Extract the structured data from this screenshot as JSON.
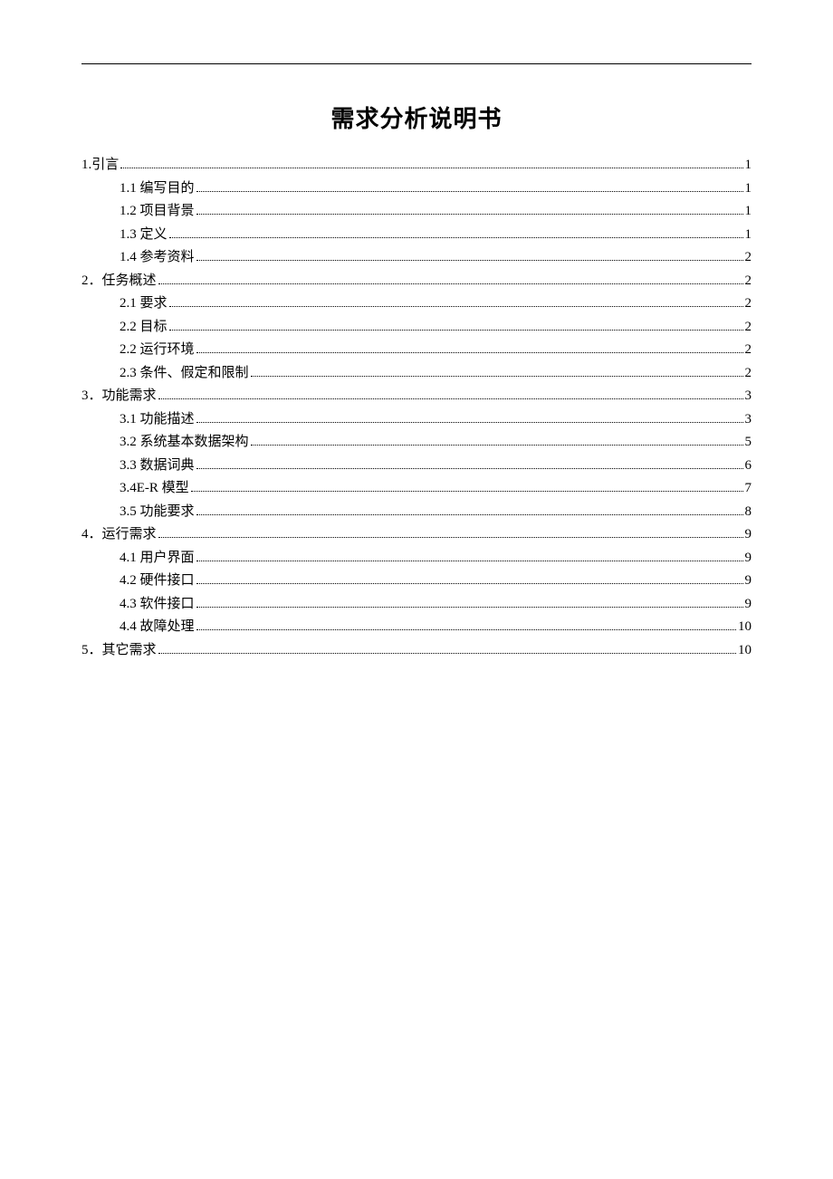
{
  "title": "需求分析说明书",
  "toc": [
    {
      "level": 1,
      "label": "1.引言",
      "page": "1"
    },
    {
      "level": 2,
      "label": "1.1 编写目的",
      "page": "1"
    },
    {
      "level": 2,
      "label": "1.2 项目背景",
      "page": "1"
    },
    {
      "level": 2,
      "label": "1.3 定义",
      "page": "1"
    },
    {
      "level": 2,
      "label": "1.4 参考资料",
      "page": "2"
    },
    {
      "level": 1,
      "label": "2．任务概述",
      "page": "2"
    },
    {
      "level": 2,
      "label": "2.1 要求",
      "page": "2"
    },
    {
      "level": 2,
      "label": "2.2 目标",
      "page": "2"
    },
    {
      "level": 2,
      "label": "2.2 运行环境",
      "page": "2"
    },
    {
      "level": 2,
      "label": "2.3 条件、假定和限制",
      "page": "2"
    },
    {
      "level": 1,
      "label": "3．功能需求",
      "page": "3"
    },
    {
      "level": 2,
      "label": "3.1 功能描述",
      "page": "3"
    },
    {
      "level": 2,
      "label": "3.2 系统基本数据架构",
      "page": "5"
    },
    {
      "level": 2,
      "label": "3.3 数据词典",
      "page": "6"
    },
    {
      "level": 2,
      "label": "3.4E-R 模型",
      "page": "7"
    },
    {
      "level": 2,
      "label": "3.5 功能要求",
      "page": "8"
    },
    {
      "level": 1,
      "label": "4．运行需求",
      "page": "9"
    },
    {
      "level": 2,
      "label": "4.1 用户界面",
      "page": "9"
    },
    {
      "level": 2,
      "label": "4.2 硬件接口",
      "page": "9"
    },
    {
      "level": 2,
      "label": "4.3 软件接口",
      "page": "9"
    },
    {
      "level": 2,
      "label": "4.4 故障处理",
      "page": "10"
    },
    {
      "level": 1,
      "label": "5．其它需求",
      "page": "10"
    }
  ]
}
